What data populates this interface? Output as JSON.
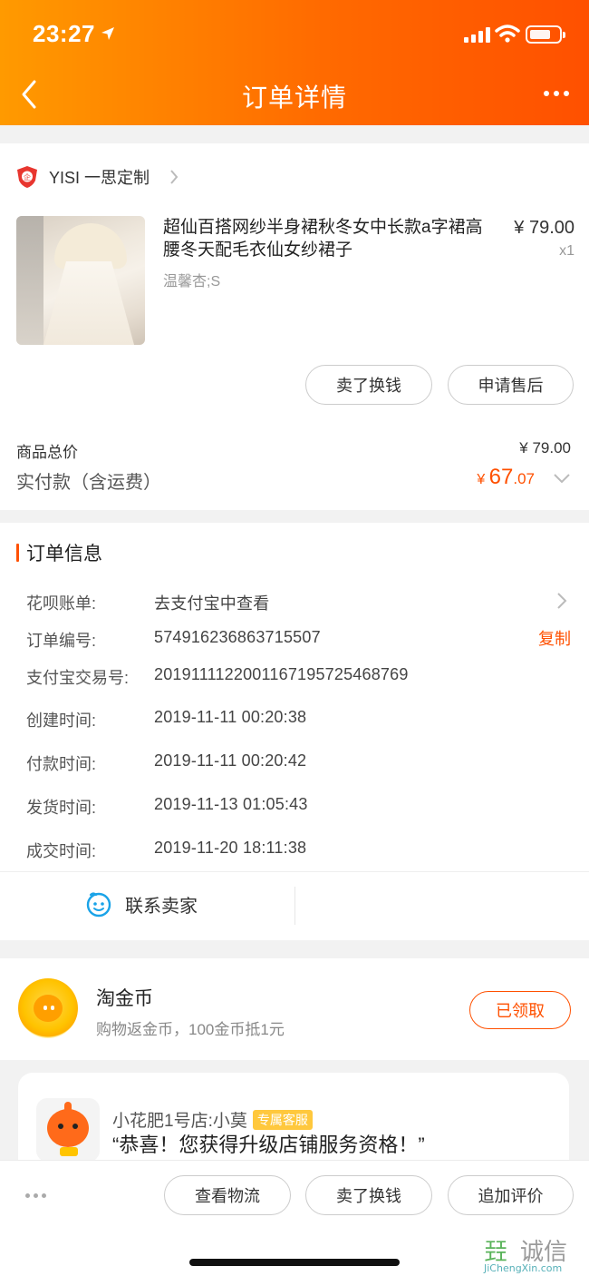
{
  "status_bar": {
    "time": "23:27"
  },
  "header": {
    "title": "订单详情"
  },
  "shop": {
    "name": "YISI  一思定制"
  },
  "product": {
    "title": "超仙百搭网纱半身裙秋冬女中长款a字裙高腰冬天配毛衣仙女纱裙子",
    "sku": "温馨杏;S",
    "price": "¥ 79.00",
    "qty": "x1"
  },
  "item_actions": {
    "resell_label": "卖了换钱",
    "after_sales_label": "申请售后"
  },
  "totals": {
    "goods_total_label": "商品总价",
    "goods_total": "¥ 79.00",
    "paid_label": "实付款（含运费）",
    "paid_currency": "¥ ",
    "paid_integer": "67",
    "paid_decimal": ".07"
  },
  "order_info": {
    "title": "订单信息",
    "rows": [
      {
        "label": "花呗账单:",
        "value": "去支付宝中查看"
      },
      {
        "label": "订单编号:",
        "value": "574916236863715507"
      },
      {
        "label": "支付宝交易号:",
        "value": "2019111122001167195725468769"
      },
      {
        "label": "创建时间:",
        "value": "2019-11-11 00:20:38"
      },
      {
        "label": "付款时间:",
        "value": "2019-11-11 00:20:42"
      },
      {
        "label": "发货时间:",
        "value": "2019-11-13 01:05:43"
      },
      {
        "label": "成交时间:",
        "value": "2019-11-20 18:11:38"
      }
    ],
    "copy_label": "复制"
  },
  "contact": {
    "label": "联系卖家"
  },
  "coins": {
    "title": "淘金币",
    "desc": "购物返金币，100金币抵1元",
    "button": "已领取"
  },
  "promo": {
    "shop": "小花肥1号店:小莫",
    "badge": "专属客服",
    "message": "“恭喜！您获得升级店铺服务资格！”"
  },
  "bottom_actions": {
    "logistics_label": "查看物流",
    "resell_label": "卖了换钱",
    "review_label": "追加评价"
  },
  "watermark": {
    "mark": "㠭",
    "text": "诚信",
    "url": "JiChengXin.com"
  },
  "colors": {
    "brand_orange": "#ff5000",
    "header_start": "#ff9a00",
    "header_end": "#ff5000"
  }
}
